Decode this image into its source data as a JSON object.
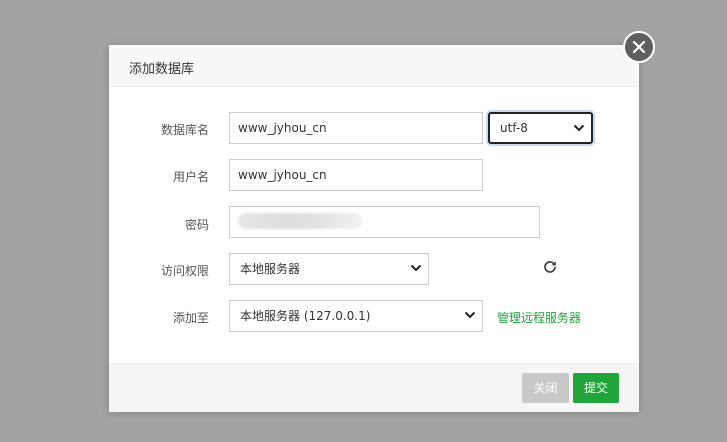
{
  "dialog": {
    "title": "添加数据库"
  },
  "form": {
    "db_name": {
      "label": "数据库名",
      "value": "www_jyhou_cn",
      "charset_selected": "utf-8"
    },
    "username": {
      "label": "用户名",
      "value": "www_jyhou_cn"
    },
    "password": {
      "label": "密码"
    },
    "access": {
      "label": "访问权限",
      "selected": "本地服务器"
    },
    "add_to": {
      "label": "添加至",
      "selected": "本地服务器 (127.0.0.1)",
      "manage_link": "管理远程服务器"
    }
  },
  "footer": {
    "close_label": "关闭",
    "submit_label": "提交"
  },
  "colors": {
    "accent": "#20a53a",
    "overlay": "#a3a3a3",
    "disabled_button": "#c9c9c9"
  },
  "icons": {
    "close": "close-icon",
    "refresh": "refresh-icon",
    "dropdown": "chevron-down-icon"
  }
}
